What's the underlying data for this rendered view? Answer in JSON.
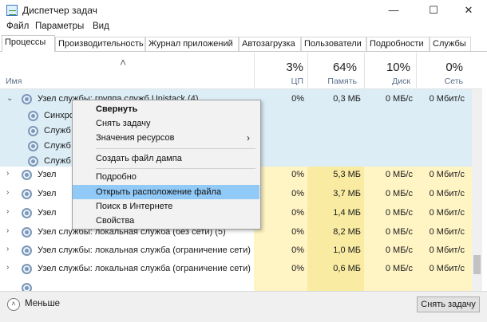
{
  "window": {
    "title": "Диспетчер задач",
    "minimize_icon": "—",
    "maximize_icon": "☐",
    "close_icon": "✕"
  },
  "menu": [
    "Файл",
    "Параметры",
    "Вид"
  ],
  "tabs": [
    "Процессы",
    "Производительность",
    "Журнал приложений",
    "Автозагрузка",
    "Пользователи",
    "Подробности",
    "Службы"
  ],
  "header": {
    "name_label": "Имя",
    "sort_arrow": "˄",
    "cpu": {
      "percent": "3%",
      "label": "ЦП"
    },
    "memory": {
      "percent": "64%",
      "label": "Память"
    },
    "disk": {
      "percent": "10%",
      "label": "Диск"
    },
    "network": {
      "percent": "0%",
      "label": "Сеть"
    }
  },
  "rows": [
    {
      "name": "Узел службы: группа служб Unistack (4)",
      "cpu": "0%",
      "memory": "0,3 МБ",
      "disk": "0 МБ/с",
      "network": "0 Мбит/с",
      "expanded": true
    },
    {
      "name": "Синхро",
      "child": true
    },
    {
      "name": "Служб",
      "child": true
    },
    {
      "name": "Служб",
      "child": true
    },
    {
      "name": "Служб",
      "child": true
    },
    {
      "name": "Узел",
      "cpu": "0%",
      "memory": "5,3 МБ",
      "disk": "0 МБ/с",
      "network": "0 Мбит/с"
    },
    {
      "name": "Узел",
      "cpu": "0%",
      "memory": "3,7 МБ",
      "disk": "0 МБ/с",
      "network": "0 Мбит/с"
    },
    {
      "name": "Узел",
      "cpu": "0%",
      "memory": "1,4 МБ",
      "disk": "0 МБ/с",
      "network": "0 Мбит/с"
    },
    {
      "name": "Узел службы: локальная служба (без сети) (5)",
      "cpu": "0%",
      "memory": "8,2 МБ",
      "disk": "0 МБ/с",
      "network": "0 Мбит/с"
    },
    {
      "name": "Узел службы: локальная служба (ограничение сети)",
      "cpu": "0%",
      "memory": "1,0 МБ",
      "disk": "0 МБ/с",
      "network": "0 Мбит/с"
    },
    {
      "name": "Узел службы: локальная служба (ограничение сети)",
      "cpu": "0%",
      "memory": "0,6 МБ",
      "disk": "0 МБ/с",
      "network": "0 Мбит/с"
    }
  ],
  "context_menu": {
    "items": [
      "Свернуть",
      "Снять задачу",
      "Значения ресурсов",
      "Создать файл дампа",
      "Подробно",
      "Открыть расположение файла",
      "Поиск в Интернете",
      "Свойства"
    ],
    "submenu_arrow": "›"
  },
  "footer": {
    "less_icon": "˄",
    "less_label": "Меньше",
    "end_task_label": "Снять задачу"
  },
  "colors": {
    "highlight": "#91c9f7",
    "expanded_group_bg": "#dcedf6",
    "resource_yellow": "#fff4c4"
  }
}
